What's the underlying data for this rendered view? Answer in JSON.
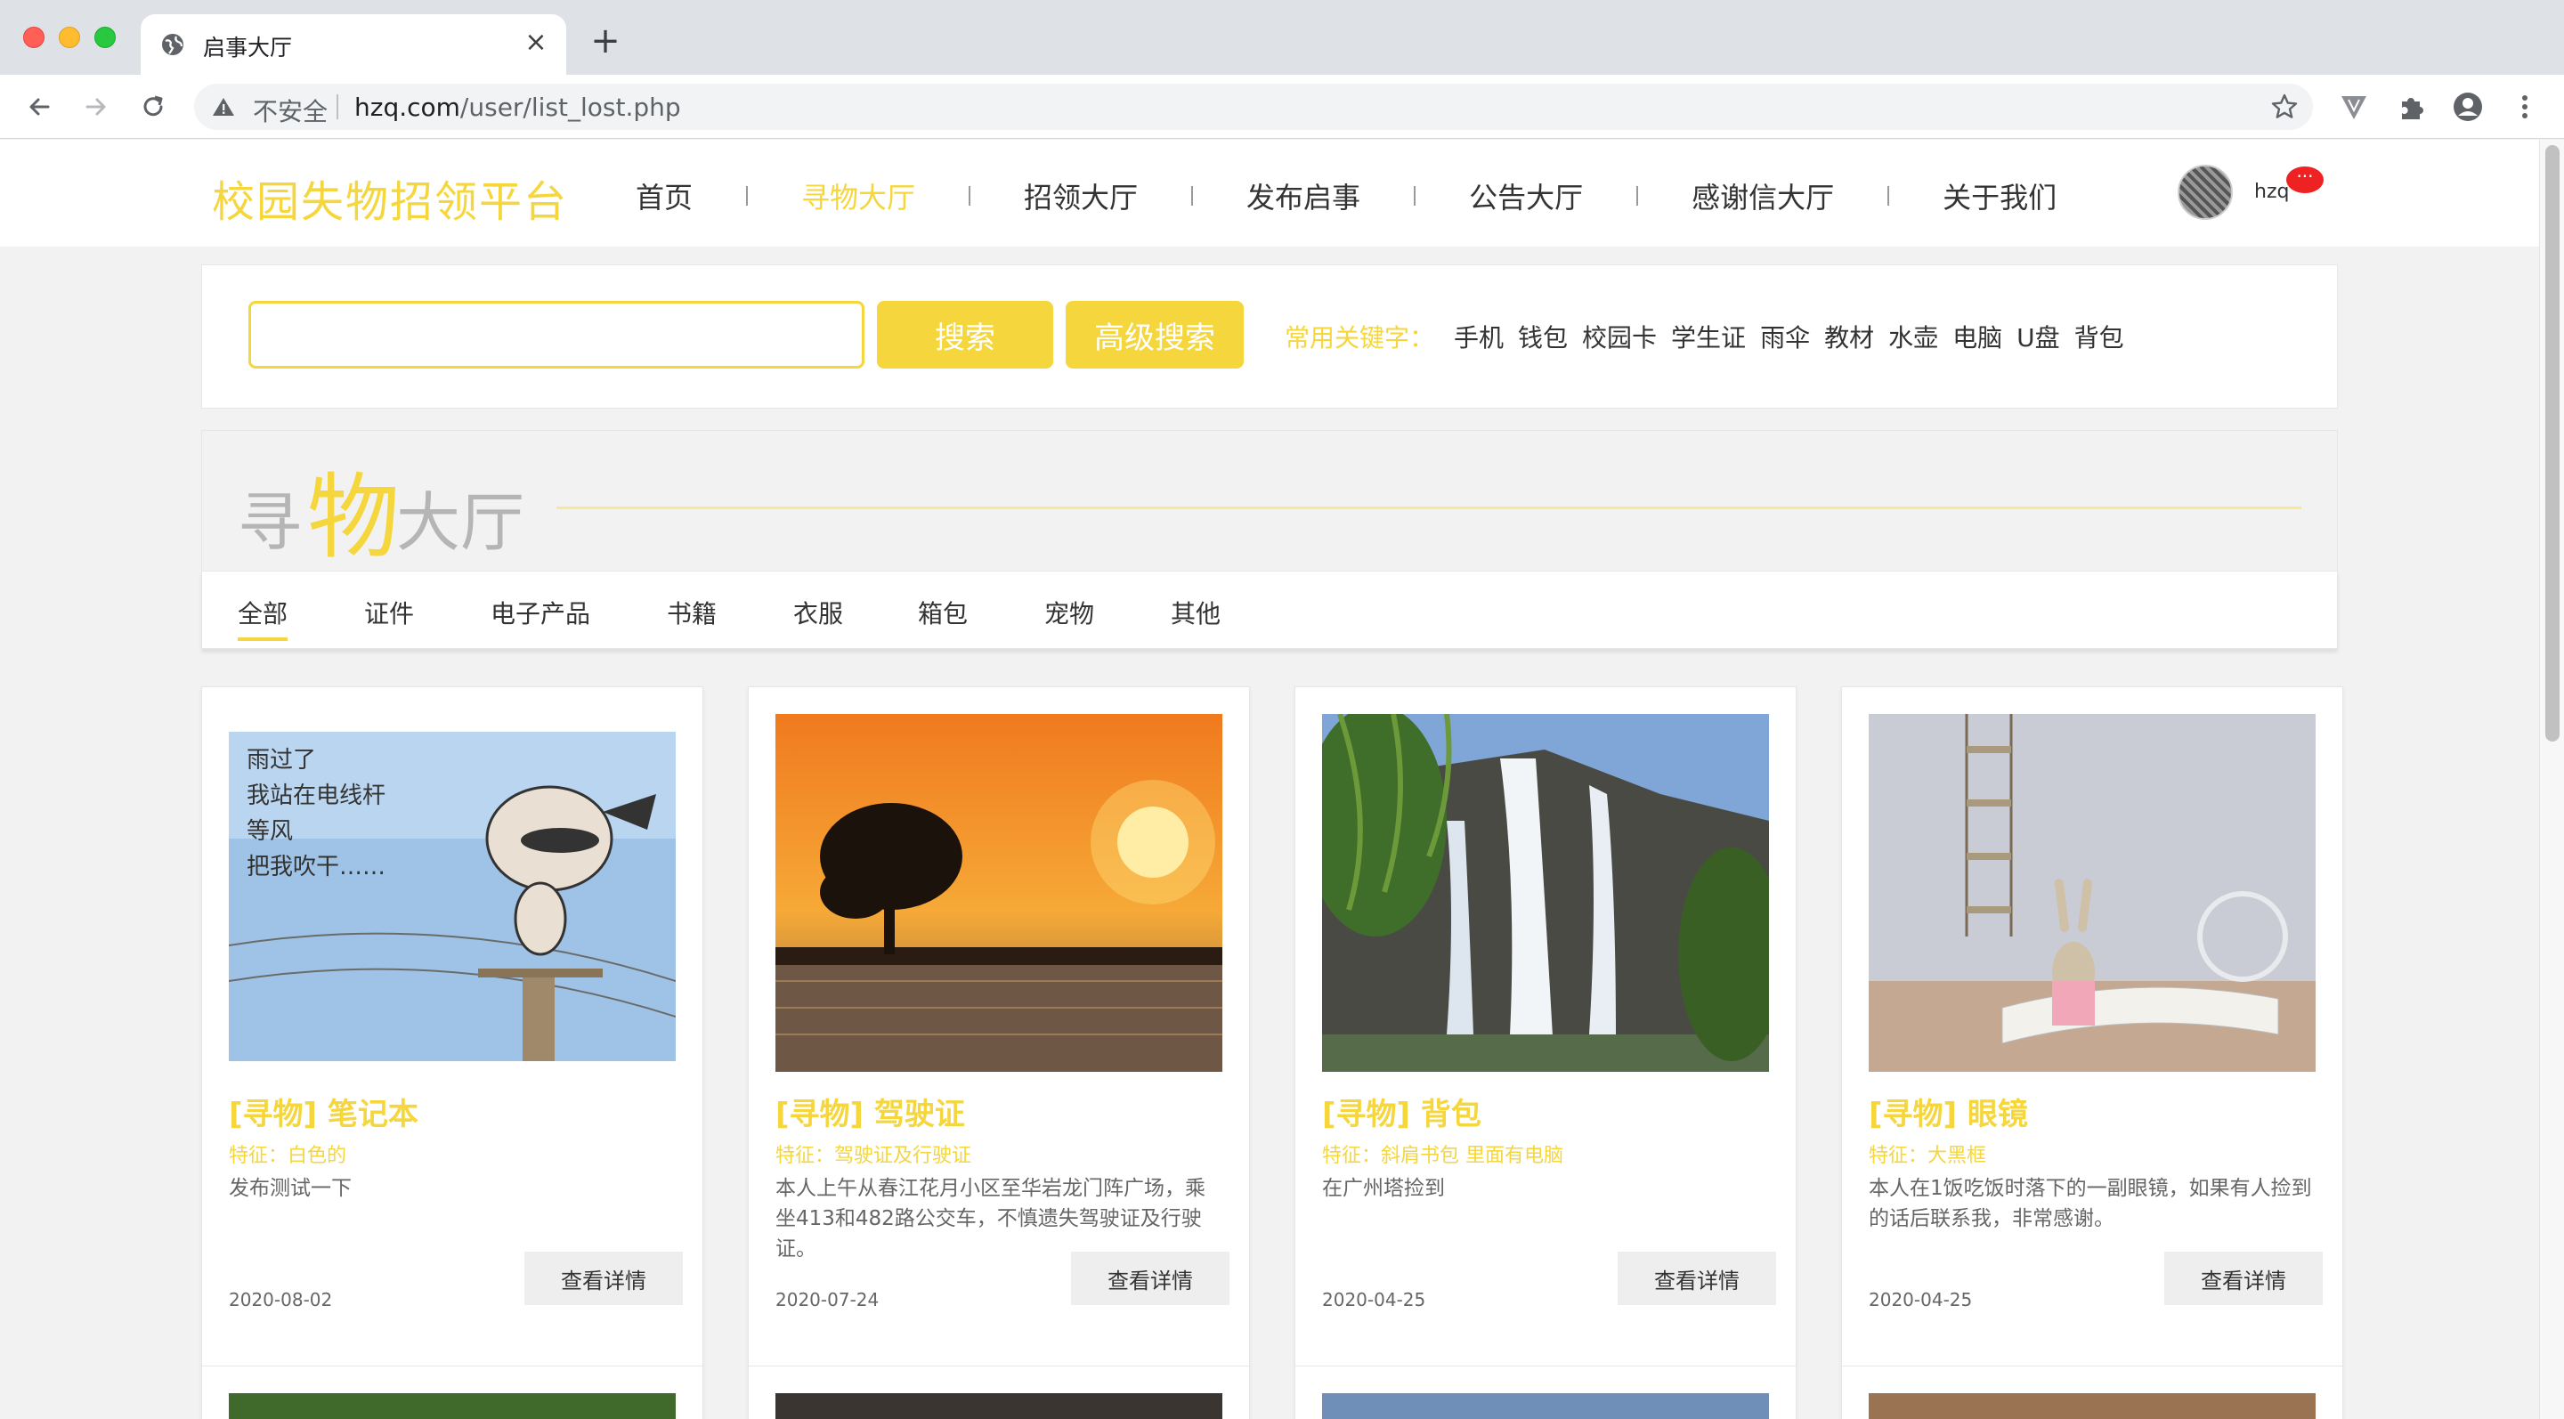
{
  "browser": {
    "tab_title": "启事大厅",
    "insecure_label": "不安全",
    "url_host": "hzq.com",
    "url_path": "/user/list_lost.php"
  },
  "header": {
    "logo": "校园失物招领平台",
    "nav": [
      {
        "label": "首页",
        "active": false
      },
      {
        "label": "寻物大厅",
        "active": true
      },
      {
        "label": "招领大厅",
        "active": false
      },
      {
        "label": "发布启事",
        "active": false
      },
      {
        "label": "公告大厅",
        "active": false
      },
      {
        "label": "感谢信大厅",
        "active": false
      },
      {
        "label": "关于我们",
        "active": false
      }
    ],
    "username": "hzq",
    "badge": "···"
  },
  "search": {
    "input_value": "",
    "search_label": "搜索",
    "advanced_label": "高级搜索",
    "keywords_label": "常用关键字：",
    "keywords": [
      "手机",
      "钱包",
      "校园卡",
      "学生证",
      "雨伞",
      "教材",
      "水壶",
      "电脑",
      "U盘",
      "背包"
    ]
  },
  "hall": {
    "char1": "寻",
    "char2": "物",
    "char3": "大厅"
  },
  "categories": [
    "全部",
    "证件",
    "电子产品",
    "书籍",
    "衣服",
    "箱包",
    "宠物",
    "其他"
  ],
  "cards": [
    {
      "title": "[寻物] 笔记本",
      "feature": "特征：白色的",
      "desc": "发布测试一下",
      "date": "2020-08-02",
      "button": "查看详情"
    },
    {
      "title": "[寻物] 驾驶证",
      "feature": "特征：驾驶证及行驶证",
      "desc": "本人上午从春江花月小区至华岩龙门阵广场，乘坐413和482路公交车，不慎遗失驾驶证及行驶证。",
      "date": "2020-07-24",
      "button": "查看详情"
    },
    {
      "title": "[寻物] 背包",
      "feature": "特征：斜肩书包 里面有电脑",
      "desc": "在广州塔捡到",
      "date": "2020-04-25",
      "button": "查看详情"
    },
    {
      "title": "[寻物] 眼镜",
      "feature": "特征：大黑框",
      "desc": "本人在1饭吃饭时落下的一副眼镜，如果有人捡到的话后联系我，非常感谢。",
      "date": "2020-04-25",
      "button": "查看详情"
    }
  ],
  "colors": {
    "accent": "#f5d63d"
  }
}
